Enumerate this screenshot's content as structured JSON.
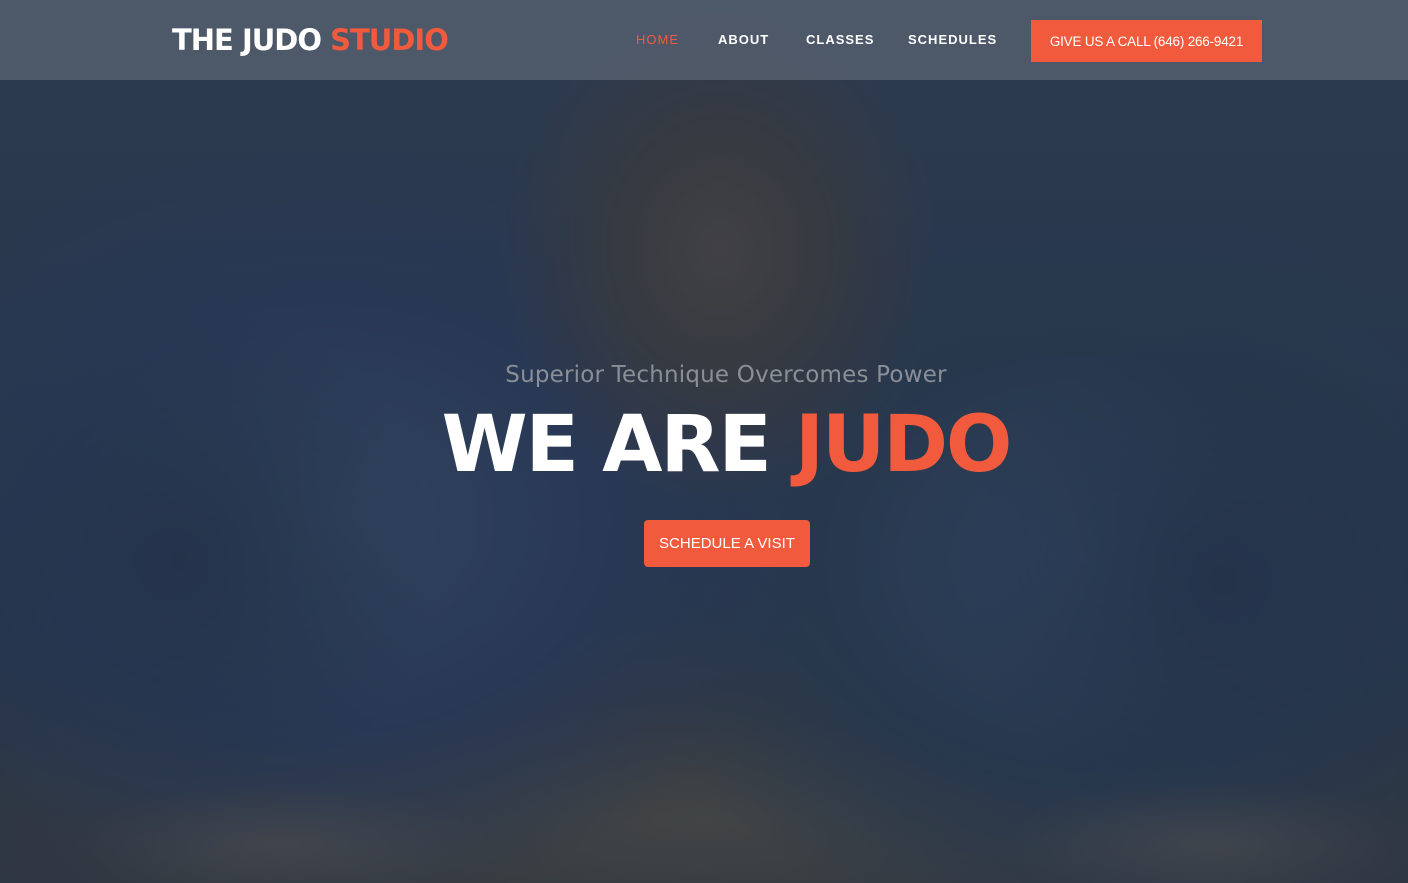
{
  "header": {
    "logo_main": "THE JUDO",
    "logo_accent": "STUDIO",
    "nav": [
      {
        "label": "HOME",
        "active": true
      },
      {
        "label": "ABOUT",
        "active": false
      },
      {
        "label": "CLASSES",
        "active": false
      },
      {
        "label": "SCHEDULES",
        "active": false
      }
    ],
    "call_button": "GIVE US A CALL (646) 266-9421"
  },
  "hero": {
    "tagline": "Superior Technique Overcomes Power",
    "headline_main": "WE ARE",
    "headline_accent": "JUDO",
    "cta_label": "SCHEDULE A VISIT"
  },
  "colors": {
    "accent": "#f15a3c",
    "text_light": "#ffffff",
    "header_bg": "#5a6473"
  }
}
